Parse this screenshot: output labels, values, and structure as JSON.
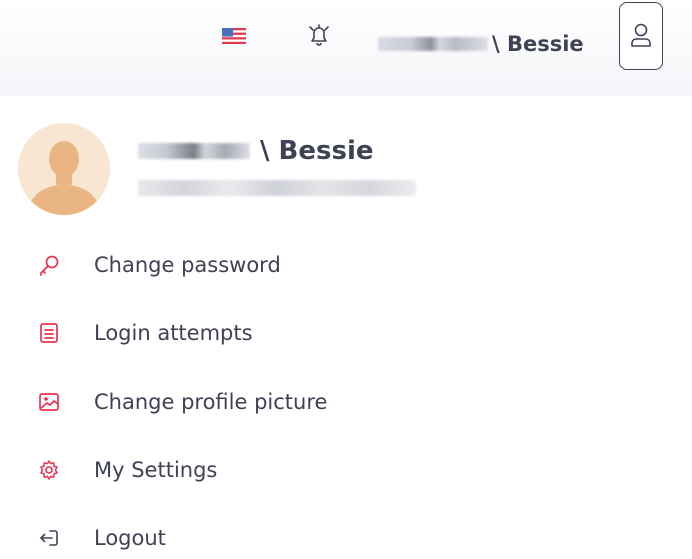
{
  "topbar": {
    "flag_icon": "us-flag-icon",
    "notifications_icon": "bell-icon",
    "user_display": "\\ Bessie",
    "user_button_icon": "user-icon"
  },
  "profile": {
    "name_suffix": "\\ Bessie",
    "avatar_icon": "default-avatar-icon"
  },
  "menu": {
    "items": [
      {
        "label": "Change password",
        "icon": "key-icon"
      },
      {
        "label": "Login attempts",
        "icon": "list-icon"
      },
      {
        "label": "Change profile picture",
        "icon": "image-icon"
      },
      {
        "label": "My Settings",
        "icon": "gear-icon"
      },
      {
        "label": "Logout",
        "icon": "logout-icon"
      }
    ]
  },
  "colors": {
    "accent": "#e8334f",
    "text": "#3f4254",
    "muted": "#8c8e99"
  }
}
